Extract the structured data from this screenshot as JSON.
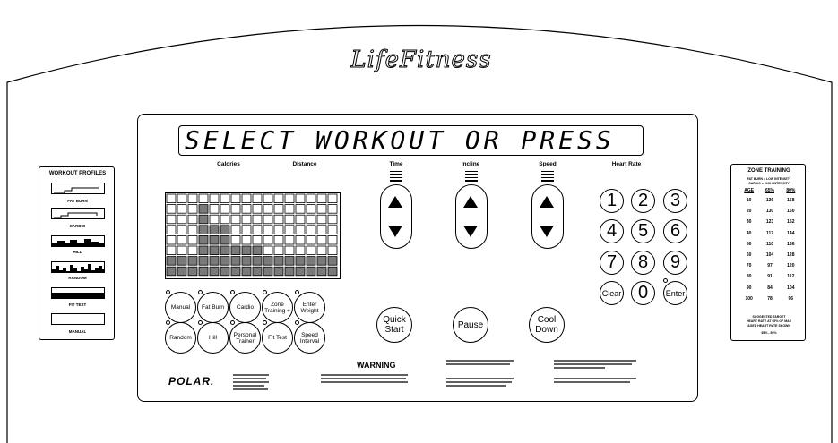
{
  "brand": {
    "logo": "LifeFitness"
  },
  "display": {
    "message": "SELECT WORKOUT OR PRESS"
  },
  "readouts": {
    "calories": "Calories",
    "distance": "Distance",
    "time": "Time",
    "incline": "Incline",
    "speed": "Speed",
    "heart_rate": "Heart Rate"
  },
  "programs": {
    "row1": [
      "Manual",
      "Fat Burn",
      "Cardio",
      "Zone Training +",
      "Enter Weight"
    ],
    "row2": [
      "Random",
      "Hill",
      "Personal Trainer",
      "Fit Test",
      "Speed Interval"
    ]
  },
  "actions": {
    "quick_start": "Quick Start",
    "pause": "Pause",
    "cool_down": "Cool Down"
  },
  "keypad": {
    "keys": [
      "1",
      "2",
      "3",
      "4",
      "5",
      "6",
      "7",
      "8",
      "9",
      "Clear",
      "0",
      "Enter"
    ]
  },
  "workout_profiles": {
    "title": "WORKOUT PROFILES",
    "items": [
      "FAT BURN",
      "CARDIO",
      "HILL",
      "RANDOM",
      "FIT TEST",
      "MANUAL"
    ]
  },
  "zone_training": {
    "title": "ZONE TRAINING",
    "subtitle_1": "FAT BURN = LOW INTENSITY",
    "subtitle_2": "CARDIO = HIGH INTENSITY",
    "headers": [
      "AGE",
      "65%",
      "80%"
    ],
    "rows": [
      [
        "10",
        "136",
        "168"
      ],
      [
        "20",
        "130",
        "160"
      ],
      [
        "30",
        "123",
        "152"
      ],
      [
        "40",
        "117",
        "144"
      ],
      [
        "50",
        "110",
        "136"
      ],
      [
        "60",
        "104",
        "128"
      ],
      [
        "70",
        "97",
        "120"
      ],
      [
        "80",
        "91",
        "112"
      ],
      [
        "90",
        "84",
        "104"
      ],
      [
        "100",
        "78",
        "96"
      ]
    ],
    "footer_1": "SUGGESTED TARGET",
    "footer_2": "HEART RATE AT 65% OF MAX",
    "footer_3": "AGED HEART RATE SHOWN",
    "footer_4": "65% - 80%"
  },
  "warning": {
    "title": "WARNING"
  },
  "polar": {
    "logo": "POLAR."
  }
}
